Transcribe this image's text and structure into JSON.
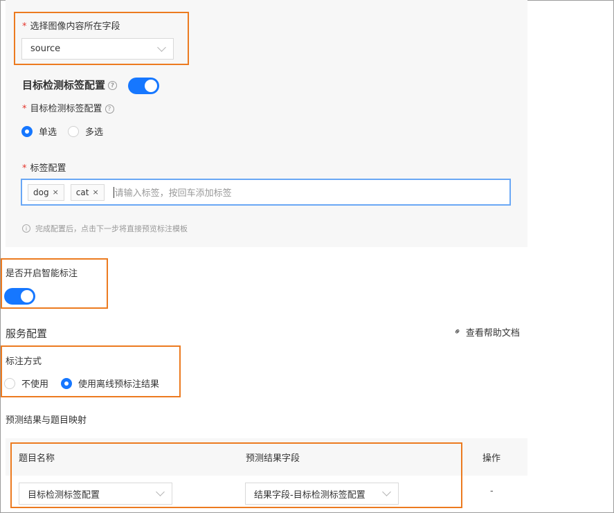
{
  "image_field": {
    "label": "选择图像内容所在字段",
    "required_mark": "*",
    "value": "source"
  },
  "detection_config": {
    "section_title": "目标检测标签配置",
    "help_icon": "question-circle-icon",
    "enabled": true,
    "field_label": "目标检测标签配置",
    "required_mark": "*",
    "options": [
      "单选",
      "多选"
    ],
    "selected_option": "单选"
  },
  "tag_config": {
    "label": "标签配置",
    "required_mark": "*",
    "tags": [
      "dog",
      "cat"
    ],
    "tag_remove_glyph": "×",
    "placeholder": "请输入标签，按回车添加标签"
  },
  "hint": {
    "icon": "info-circle-icon",
    "text": "完成配置后，点击下一步将直接预览标注模板"
  },
  "smart_annotation": {
    "label": "是否开启智能标注",
    "enabled": true
  },
  "service_config": {
    "title": "服务配置",
    "help_link": "查看帮助文档",
    "help_link_icon": "link-icon"
  },
  "annotation_mode": {
    "label": "标注方式",
    "options": [
      "不使用",
      "使用离线预标注结果"
    ],
    "selected_option": "使用离线预标注结果"
  },
  "mapping": {
    "title": "预测结果与题目映射",
    "columns": [
      "题目名称",
      "预测结果字段",
      "操作"
    ],
    "rows": [
      {
        "question": "目标检测标签配置",
        "result_field": "结果字段-目标检测标签配置",
        "action": "-"
      }
    ]
  },
  "colors": {
    "accent": "#1677ff",
    "highlight": "#ec7a1f",
    "required": "#e5352b"
  }
}
